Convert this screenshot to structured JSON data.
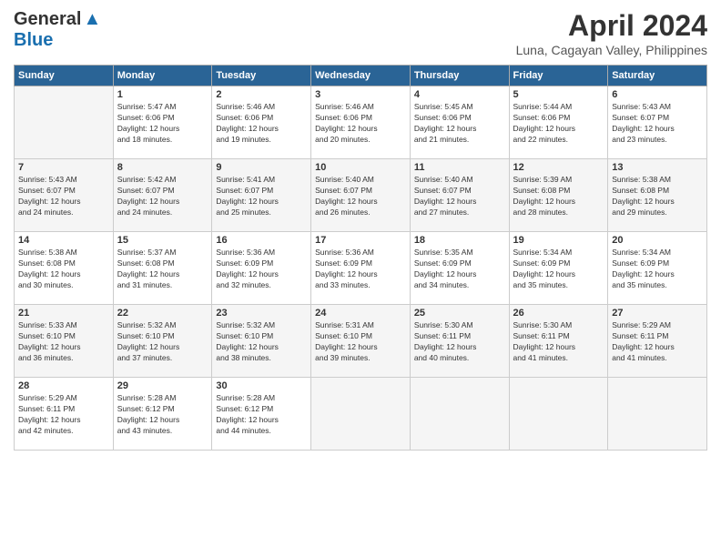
{
  "header": {
    "logo_general": "General",
    "logo_blue": "Blue",
    "month_title": "April 2024",
    "subtitle": "Luna, Cagayan Valley, Philippines"
  },
  "calendar": {
    "days_of_week": [
      "Sunday",
      "Monday",
      "Tuesday",
      "Wednesday",
      "Thursday",
      "Friday",
      "Saturday"
    ],
    "weeks": [
      [
        {
          "day": "",
          "info": ""
        },
        {
          "day": "1",
          "info": "Sunrise: 5:47 AM\nSunset: 6:06 PM\nDaylight: 12 hours\nand 18 minutes."
        },
        {
          "day": "2",
          "info": "Sunrise: 5:46 AM\nSunset: 6:06 PM\nDaylight: 12 hours\nand 19 minutes."
        },
        {
          "day": "3",
          "info": "Sunrise: 5:46 AM\nSunset: 6:06 PM\nDaylight: 12 hours\nand 20 minutes."
        },
        {
          "day": "4",
          "info": "Sunrise: 5:45 AM\nSunset: 6:06 PM\nDaylight: 12 hours\nand 21 minutes."
        },
        {
          "day": "5",
          "info": "Sunrise: 5:44 AM\nSunset: 6:06 PM\nDaylight: 12 hours\nand 22 minutes."
        },
        {
          "day": "6",
          "info": "Sunrise: 5:43 AM\nSunset: 6:07 PM\nDaylight: 12 hours\nand 23 minutes."
        }
      ],
      [
        {
          "day": "7",
          "info": "Sunrise: 5:43 AM\nSunset: 6:07 PM\nDaylight: 12 hours\nand 24 minutes."
        },
        {
          "day": "8",
          "info": "Sunrise: 5:42 AM\nSunset: 6:07 PM\nDaylight: 12 hours\nand 24 minutes."
        },
        {
          "day": "9",
          "info": "Sunrise: 5:41 AM\nSunset: 6:07 PM\nDaylight: 12 hours\nand 25 minutes."
        },
        {
          "day": "10",
          "info": "Sunrise: 5:40 AM\nSunset: 6:07 PM\nDaylight: 12 hours\nand 26 minutes."
        },
        {
          "day": "11",
          "info": "Sunrise: 5:40 AM\nSunset: 6:07 PM\nDaylight: 12 hours\nand 27 minutes."
        },
        {
          "day": "12",
          "info": "Sunrise: 5:39 AM\nSunset: 6:08 PM\nDaylight: 12 hours\nand 28 minutes."
        },
        {
          "day": "13",
          "info": "Sunrise: 5:38 AM\nSunset: 6:08 PM\nDaylight: 12 hours\nand 29 minutes."
        }
      ],
      [
        {
          "day": "14",
          "info": "Sunrise: 5:38 AM\nSunset: 6:08 PM\nDaylight: 12 hours\nand 30 minutes."
        },
        {
          "day": "15",
          "info": "Sunrise: 5:37 AM\nSunset: 6:08 PM\nDaylight: 12 hours\nand 31 minutes."
        },
        {
          "day": "16",
          "info": "Sunrise: 5:36 AM\nSunset: 6:09 PM\nDaylight: 12 hours\nand 32 minutes."
        },
        {
          "day": "17",
          "info": "Sunrise: 5:36 AM\nSunset: 6:09 PM\nDaylight: 12 hours\nand 33 minutes."
        },
        {
          "day": "18",
          "info": "Sunrise: 5:35 AM\nSunset: 6:09 PM\nDaylight: 12 hours\nand 34 minutes."
        },
        {
          "day": "19",
          "info": "Sunrise: 5:34 AM\nSunset: 6:09 PM\nDaylight: 12 hours\nand 35 minutes."
        },
        {
          "day": "20",
          "info": "Sunrise: 5:34 AM\nSunset: 6:09 PM\nDaylight: 12 hours\nand 35 minutes."
        }
      ],
      [
        {
          "day": "21",
          "info": "Sunrise: 5:33 AM\nSunset: 6:10 PM\nDaylight: 12 hours\nand 36 minutes."
        },
        {
          "day": "22",
          "info": "Sunrise: 5:32 AM\nSunset: 6:10 PM\nDaylight: 12 hours\nand 37 minutes."
        },
        {
          "day": "23",
          "info": "Sunrise: 5:32 AM\nSunset: 6:10 PM\nDaylight: 12 hours\nand 38 minutes."
        },
        {
          "day": "24",
          "info": "Sunrise: 5:31 AM\nSunset: 6:10 PM\nDaylight: 12 hours\nand 39 minutes."
        },
        {
          "day": "25",
          "info": "Sunrise: 5:30 AM\nSunset: 6:11 PM\nDaylight: 12 hours\nand 40 minutes."
        },
        {
          "day": "26",
          "info": "Sunrise: 5:30 AM\nSunset: 6:11 PM\nDaylight: 12 hours\nand 41 minutes."
        },
        {
          "day": "27",
          "info": "Sunrise: 5:29 AM\nSunset: 6:11 PM\nDaylight: 12 hours\nand 41 minutes."
        }
      ],
      [
        {
          "day": "28",
          "info": "Sunrise: 5:29 AM\nSunset: 6:11 PM\nDaylight: 12 hours\nand 42 minutes."
        },
        {
          "day": "29",
          "info": "Sunrise: 5:28 AM\nSunset: 6:12 PM\nDaylight: 12 hours\nand 43 minutes."
        },
        {
          "day": "30",
          "info": "Sunrise: 5:28 AM\nSunset: 6:12 PM\nDaylight: 12 hours\nand 44 minutes."
        },
        {
          "day": "",
          "info": ""
        },
        {
          "day": "",
          "info": ""
        },
        {
          "day": "",
          "info": ""
        },
        {
          "day": "",
          "info": ""
        }
      ]
    ]
  }
}
